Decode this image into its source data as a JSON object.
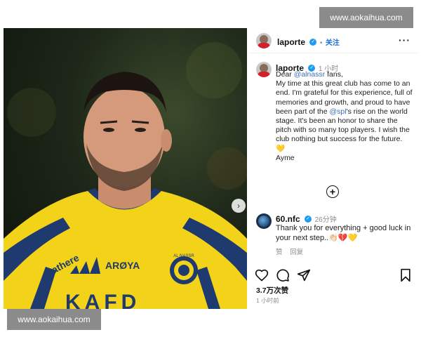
{
  "photo": {
    "sponsor_text": "Gathere",
    "brand_text": "ARØYA",
    "crest_text": "AL NASSR",
    "kit_text": "KAFD",
    "next_glyph": "›"
  },
  "header": {
    "username": "laporte",
    "separator": "•",
    "follow_label": "关注",
    "more_label": "···"
  },
  "post": {
    "username": "laporte",
    "time": "1 小时",
    "caption_parts": {
      "p1": "Dear ",
      "mention1": "@alnassr",
      "p2": " fans,",
      "p3": "My time at this great club has come to an end. I'm grateful for this experience, full of memories and growth, and proud to have been part of the ",
      "mention2": "@spl",
      "p4": "'s rise on the world stage. It's been an honor to share the pitch with so many top players. I wish the club nothing but success for the future. 💛",
      "signoff": "Ayme"
    }
  },
  "comment": {
    "username": "60.nfc",
    "time": "26分钟",
    "text": "Thank you for everything + good luck in your next step..👏🏻💔💛",
    "like_label": "赞",
    "reply_label": "回复"
  },
  "footer": {
    "likes": "3.7万次赞",
    "time": "1 小时前"
  },
  "watermarks": {
    "top": "www.aokaihua.com",
    "bottom": "www.aokaihua.com"
  },
  "colors": {
    "jersey_yellow": "#f3d21a",
    "jersey_navy": "#1e3a6e",
    "verified_blue": "#1d9bf0",
    "follow_blue": "#1d6fd6",
    "mention_blue": "#3b6fb6"
  },
  "icons": [
    "verified-icon",
    "add-circle-icon",
    "heart-icon",
    "comment-icon",
    "share-icon",
    "bookmark-icon",
    "next-icon"
  ]
}
